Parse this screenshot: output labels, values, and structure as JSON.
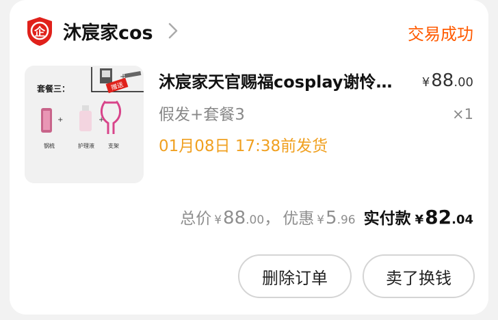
{
  "shop": {
    "name": "沐宸家cos",
    "icon": "tmall-red-shield-icon",
    "icon_char": "企"
  },
  "order": {
    "status": "交易成功"
  },
  "product": {
    "image_text": {
      "set_label": "套餐三：",
      "gift_label": "赠送",
      "items": [
        "钢梳",
        "护理液",
        "支架"
      ]
    },
    "title": "沐宸家天官赐福cosplay谢怜…",
    "price": {
      "currency": "¥",
      "int": "88",
      "dec": ".00"
    },
    "variant": "假发+套餐3",
    "quantity": "×1",
    "shipping": "01月08日 17:38前发货"
  },
  "summary": {
    "total_label": "总价",
    "total": {
      "currency": "¥",
      "int": "88",
      "dec": ".00"
    },
    "separator": "，",
    "discount_label": "优惠",
    "discount": {
      "currency": "¥",
      "int": "5",
      "dec": ".96"
    },
    "paid_label": "实付款",
    "paid": {
      "currency": "¥",
      "int": "82",
      "dec": ".04"
    }
  },
  "actions": {
    "delete_label": "删除订单",
    "sell_label": "卖了换钱"
  },
  "colors": {
    "status_orange": "#ff5a00",
    "shipping_orange": "#f0a020",
    "tmall_red": "#e0211b"
  }
}
